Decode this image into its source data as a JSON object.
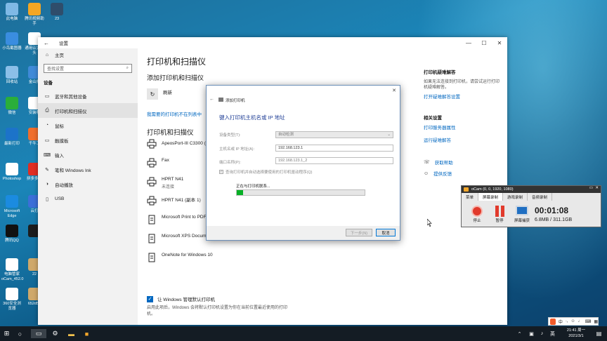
{
  "desktop_icons": [
    {
      "label": "此电脑",
      "color": "#7fb9e6"
    },
    {
      "label": "腾讯视频助手",
      "color": "#f5a623"
    },
    {
      "label": "23",
      "color": "#2f4d6b"
    },
    {
      "label": "小鸟截图器",
      "color": "#3a8de0"
    },
    {
      "label": "通用认证像头",
      "color": "#ffffff"
    },
    {
      "label": "回收站",
      "color": "#8bbfe8"
    },
    {
      "label": "金山打",
      "color": "#3f8ad8"
    },
    {
      "label": "微信",
      "color": "#2aae3a"
    },
    {
      "label": "安装程",
      "color": "#ffffff"
    },
    {
      "label": "最新打印",
      "color": "#1c73c9"
    },
    {
      "label": "千牛工",
      "color": "#f06e2c"
    },
    {
      "label": "Photoshop",
      "color": "#ffffff"
    },
    {
      "label": "拼多多打",
      "color": "#e02e24"
    },
    {
      "label": "Microsoft Edge",
      "color": "#1b8be0"
    },
    {
      "label": "云打",
      "color": "#3b6fd8"
    },
    {
      "label": "腾讯QQ",
      "color": "#111111"
    },
    {
      "label": "",
      "color": "#1d1d1d"
    },
    {
      "label": "电脑管家 oCam_452.0",
      "color": "#ffffff"
    },
    {
      "label": "22",
      "color": "#cfa86a"
    },
    {
      "label": "360安全浏览器",
      "color": "#ffffff"
    },
    {
      "label": "652d50",
      "color": "#cfa86a"
    }
  ],
  "settings": {
    "window_title": "设置",
    "sidebar": {
      "home": "主页",
      "search_placeholder": "查找设置",
      "section": "设备",
      "items": [
        "蓝牙和其他设备",
        "打印机和扫描仪",
        "鼠标",
        "触摸板",
        "输入",
        "笔和 Windows Ink",
        "自动播放",
        "USB"
      ]
    },
    "main": {
      "title": "打印机和扫描仪",
      "add_title": "添加打印机和扫描仪",
      "refresh": "刷新",
      "not_listed": "我需要的打印机不在列表中",
      "list_title": "打印机和扫描仪",
      "printers": [
        {
          "name": "ApeosPort-III C3300 (复",
          "status": ""
        },
        {
          "name": "Fax",
          "status": ""
        },
        {
          "name": "HPRT N41",
          "status": "未连接"
        },
        {
          "name": "HPRT N41 (副本 1)",
          "status": ""
        },
        {
          "name": "Microsoft Print to PDF",
          "status": ""
        },
        {
          "name": "Microsoft XPS Docume",
          "status": ""
        },
        {
          "name": "OneNote for Windows 10",
          "status": ""
        }
      ],
      "default_checkbox": "让 Windows 管理默认打印机",
      "default_desc": "启用此项后，Windows 会将默认打印机设置为你在当前位置最近使用的打印机。"
    },
    "right": {
      "troubleshoot_title": "打印机疑难解答",
      "troubleshoot_desc": "如果无法连接到打印机，请尝试运行打印机疑难解答。",
      "troubleshoot_link": "打开疑难解答设置",
      "related_title": "相关设置",
      "related_links": [
        "打印服务器属性",
        "运行疑难解答"
      ],
      "help": "获取帮助",
      "feedback": "提供反馈"
    }
  },
  "dialog": {
    "title": "添加打印机",
    "heading": "键入打印机主机名或 IP 地址",
    "device_type_label": "设备类型(T):",
    "device_type_value": "自动检测",
    "host_label": "主机名或 IP 地址(A):",
    "host_value": "192.168.123.1",
    "port_label": "端口名称(P):",
    "port_value": "192.168.123.1_2",
    "query_checkbox": "查询打印机并自动选择要使用的打印机驱动程序(Q)",
    "searching": "正在与打印机联系...",
    "progress": 0.05,
    "next": "下一步(N)",
    "cancel": "取消"
  },
  "ocam": {
    "title": "oCam (0, 0, 1920, 1080)",
    "tabs": [
      "菜单",
      "屏幕录制",
      "游戏录制",
      "音频录制"
    ],
    "tools": [
      "停止",
      "暂停",
      "屏幕捕获"
    ],
    "time": "00:01:08",
    "size": "6.8MB / 311.1GB"
  },
  "taskbar": {
    "time": "21:41 周一",
    "date": "2021/3/1",
    "ime": "英"
  }
}
